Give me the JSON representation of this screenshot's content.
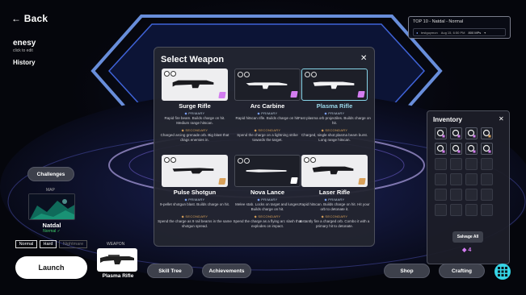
{
  "nav": {
    "back_label": "Back"
  },
  "profile": {
    "name": "enesy",
    "hint": "click to edit",
    "history_label": "History"
  },
  "leaderboard": {
    "title": "TOP 10 - Natdal - Normal",
    "entry_player": "testguymon",
    "entry_date": "Aug 15, 6:50 PM",
    "entry_score": "800 MPs"
  },
  "modal": {
    "title": "Select Weapon",
    "close_icon": "close-icon",
    "weapons": [
      {
        "name": "Surge Rifle",
        "primary_label": "PRIMARY",
        "primary_desc": "Rapid fire beam. Builds charge on hit. Medium range hitscan.",
        "secondary_label": "SECONDARY",
        "secondary_desc": "Charged arcing grenade orb. Big blast that drags enemies in.",
        "selected": false
      },
      {
        "name": "Arc Carbine",
        "primary_label": "PRIMARY",
        "primary_desc": "Rapid hitscan rifle. Builds charge on hit.",
        "secondary_label": "SECONDARY",
        "secondary_desc": "Spend the charge on a lightning strike towards the target.",
        "selected": false
      },
      {
        "name": "Plasma Rifle",
        "primary_label": "PRIMARY",
        "primary_desc": "Fast plasma orb projectiles. Builds charge on hit.",
        "secondary_label": "SECONDARY",
        "secondary_desc": "Charged, single shot plasma beam burst. Long range hitscan.",
        "selected": true
      },
      {
        "name": "Pulse Shotgun",
        "primary_label": "PRIMARY",
        "primary_desc": "9-pellet shotgun blast. Builds charge on hit.",
        "secondary_label": "SECONDARY",
        "secondary_desc": "Spend the charge as 9 rail beams in the same shotgun spread.",
        "selected": false
      },
      {
        "name": "Nova Lance",
        "primary_label": "PRIMARY",
        "primary_desc": "Melee stab. Locks on target and lunges. Builds charge on hit.",
        "secondary_label": "SECONDARY",
        "secondary_desc": "Spend the charge as a flying arc slash that explodes on impact.",
        "selected": false
      },
      {
        "name": "Laser Rifle",
        "primary_label": "PRIMARY",
        "primary_desc": "Rapid hitscan. Builds charge on hit. Hit your orb to detonate it.",
        "secondary_label": "SECONDARY",
        "secondary_desc": "Instantly fire a charged orb. Combo it with a primary hit to detonate.",
        "selected": false
      }
    ]
  },
  "inventory": {
    "title": "Inventory",
    "salvage_label": "Salvage All",
    "gem_count": "4"
  },
  "sidebar": {
    "challenges_label": "Challenges",
    "map_label": "MAP",
    "map_name": "Natdal",
    "map_difficulty": "Normal ✓"
  },
  "difficulty": [
    {
      "label": "Normal"
    },
    {
      "label": "Hard"
    },
    {
      "label": "Nightmare"
    }
  ],
  "launch_label": "Launch",
  "weapon_slot": {
    "label": "WEAPON",
    "name": "Plasma Rifle"
  },
  "bottom_bar": {
    "skill_tree": "Skill Tree",
    "achievements": "Achievements",
    "shop": "Shop",
    "crafting": "Crafting"
  },
  "colors": {
    "accent": "#36d4e6",
    "selected": "#9ad6e8",
    "secondary": "#d9a15a",
    "gem": "#d37cf0"
  }
}
